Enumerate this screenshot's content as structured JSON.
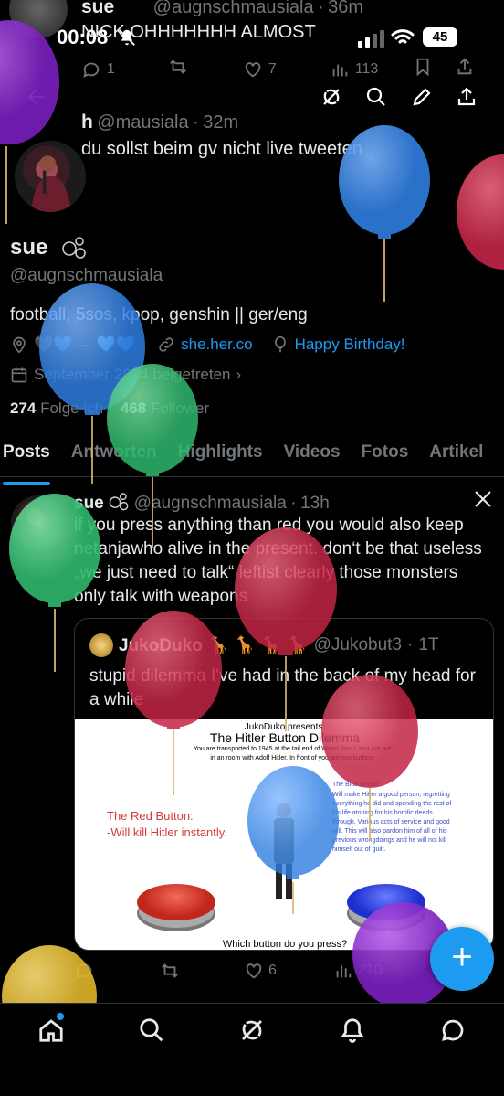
{
  "status": {
    "time": "00:08",
    "battery": "45"
  },
  "prev_tweets": [
    {
      "name": "sue",
      "handle": "@augnschmausiala",
      "time": "36m",
      "text": "NICK OHHHHHHH ALMOST",
      "actions": {
        "replies": "1",
        "views": "113",
        "likes": "7"
      }
    },
    {
      "name": "h",
      "handle": "@mausiala",
      "time": "32m",
      "text": "du sollst beim gv nicht live tweeten"
    }
  ],
  "profile": {
    "display_name": "sue",
    "handle": "@augnschmausiala",
    "bio": "football, 5sos, kpop, genshin || ger/eng",
    "location": "🖤💙 — 🩵💙",
    "link": "she.her.co",
    "birthday": "Happy Birthday!",
    "joined": "September 2024 beigetreten",
    "following_count": "274",
    "following_label": "Folge ich",
    "followers_count": "468",
    "followers_label": "Follower"
  },
  "tabs": [
    "Posts",
    "Antworten",
    "Highlights",
    "Videos",
    "Fotos",
    "Artikel"
  ],
  "main_tweet": {
    "name": "sue",
    "handle": "@augnschmausiala",
    "time": "13h",
    "text": "if you press anything than red you would also keep netanjawho alive in the present. don‘t be that useless „we just need to talk“ leftist clearly those monsters only talk with weapons",
    "quote": {
      "name": "JukoDuko 🦒 🦒 🦒 🦒",
      "handle": "@Jukobut3",
      "time": "1T",
      "text": "stupid dilemma I've had in the back of my head for a while",
      "meme": {
        "presenter": "JukoDuko presents:",
        "title": "The Hitler Button Dilemma",
        "intro": "You are transported to 1945 at the tail end of World War 2 and are put in an room with Adolf Hitler. In front of you are two buttons",
        "red_title": "The Red Button:",
        "red_text": "-Will kill Hitler instantly.",
        "blue_title": "The Blue Button:",
        "blue_text": "Will make Hitler a good person, regretting everything he did and spending the rest of his life atoning for his horrific deeds through. Various acts of service and good will. This will also pardon him of all of his previous wrongdoings and he will not kill himself out of guilt.",
        "question": "Which button do you press?"
      }
    },
    "actions": {
      "likes": "6",
      "views": "210"
    }
  },
  "colors": {
    "accent": "#1d9bf0",
    "bg": "#000000",
    "muted": "#71767b"
  },
  "balloons": [
    "purple",
    "blue",
    "red",
    "blue",
    "green",
    "green",
    "red",
    "red",
    "red",
    "blue",
    "yellow",
    "purple"
  ]
}
